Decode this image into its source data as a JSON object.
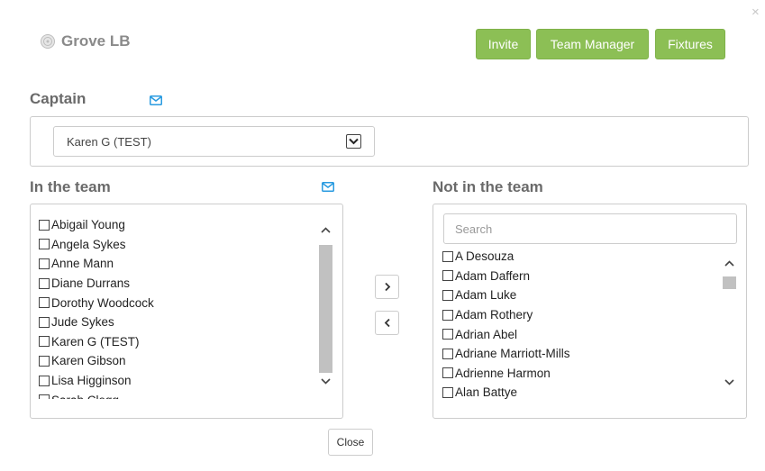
{
  "window": {
    "close_glyph": "×"
  },
  "brand": {
    "name": "Grove LB",
    "icon": "badge-icon"
  },
  "header_buttons": {
    "invite": "Invite",
    "team_manager": "Team Manager",
    "fixtures": "Fixtures"
  },
  "captain": {
    "title": "Captain",
    "selected": "Karen G (TEST)"
  },
  "in_team": {
    "title": "In the team",
    "members": [
      "Abigail Young",
      "Angela Sykes",
      "Anne Mann",
      "Diane Durrans",
      "Dorothy Woodcock",
      "Jude Sykes",
      "Karen G (TEST)",
      "Karen Gibson",
      "Lisa Higginson",
      "Sarah Clegg"
    ]
  },
  "not_in_team": {
    "title": "Not in the team",
    "search_placeholder": "Search",
    "members": [
      "A Desouza",
      "Adam Daffern",
      "Adam Luke",
      "Adam Rothery",
      "Adrian Abel",
      "Adriane Marriott-Mills",
      "Adrienne Harmon",
      "Alan Battye"
    ]
  },
  "move_buttons": {
    "add": "›",
    "remove": "‹"
  },
  "footer": {
    "close_label": "Close"
  },
  "colors": {
    "accent_green": "#8cbf55",
    "mail_blue": "#2a9be0"
  }
}
